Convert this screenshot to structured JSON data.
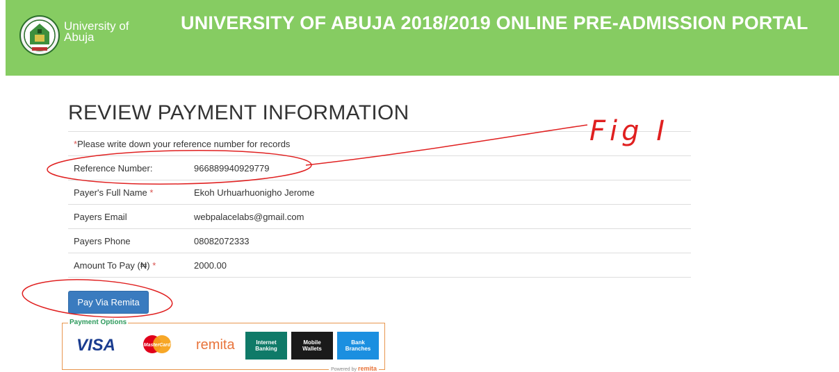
{
  "header": {
    "logo_text_line1": "University of",
    "logo_text_line2": "Abuja",
    "portal_title": "UNIVERSITY OF ABUJA 2018/2019 ONLINE PRE-ADMISSION PORTAL"
  },
  "page": {
    "heading": "REVIEW PAYMENT INFORMATION",
    "note": "*Please write down your reference number for records"
  },
  "fields": [
    {
      "label": "Reference Number:",
      "required": "",
      "value": "966889940929779"
    },
    {
      "label": "Payer's Full Name",
      "required": "*",
      "value": "Ekoh Urhuarhuonigho Jerome"
    },
    {
      "label": "Payers Email",
      "required": "",
      "value": "webpalacelabs@gmail.com"
    },
    {
      "label": "Payers Phone",
      "required": "",
      "value": "08082072333"
    },
    {
      "label": "Amount To Pay (₦)",
      "required": "*",
      "value": "2000.00"
    }
  ],
  "actions": {
    "pay_label": "Pay Via Remita"
  },
  "payment_options": {
    "title": "Payment Options",
    "visa": "VISA",
    "mastercard": "MasterCard",
    "remita": "remita",
    "internet_banking": "Internet\nBanking",
    "mobile_wallets": "Mobile\nWallets",
    "bank_branches": "Bank\nBranches",
    "powered_by": "Powered by",
    "powered_brand": "remita"
  },
  "annotation": {
    "fig_label": "Fig I"
  },
  "colors": {
    "header_bg": "#86cc62",
    "button_bg": "#3a7bbf",
    "annotation_red": "#e02020"
  }
}
